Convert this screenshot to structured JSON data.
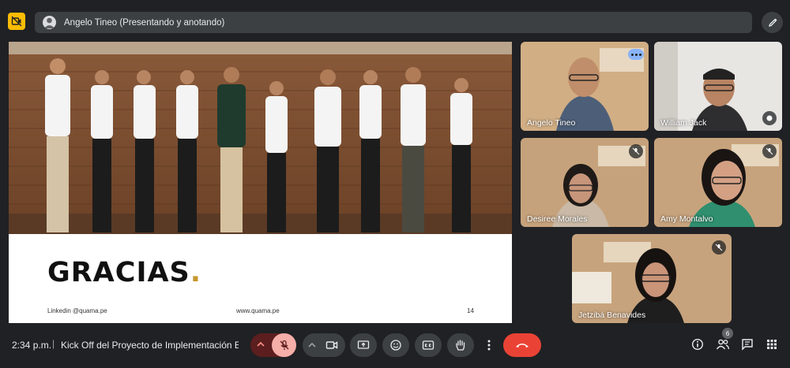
{
  "header": {
    "presenter_label": "Angelo Tineo (Presentando y anotando)"
  },
  "slide": {
    "title": "GRACIAS",
    "title_dot": ".",
    "footer_left": "Linkedin @quama.pe",
    "footer_center": "www.quama.pe",
    "page_number": "14"
  },
  "participants": [
    {
      "name": "Angelo Tineo",
      "status": "speaking"
    },
    {
      "name": "William Jack",
      "status": ""
    },
    {
      "name": "Desiree Morales",
      "status": "muted"
    },
    {
      "name": "Amy Montalvo",
      "status": "muted"
    },
    {
      "name": "Jetzibá Benavides",
      "status": "muted"
    }
  ],
  "footer": {
    "time": "2:34 p.m.",
    "separator": "|",
    "meeting_title": "Kick Off del Proyecto de Implementación Ex...",
    "participant_count": "6"
  },
  "icons": {
    "meet": "meet-logo-icon",
    "annotate": "pen-icon",
    "mic": "mic-off-icon",
    "camera": "camera-icon",
    "present": "present-screen-icon",
    "emoji": "emoji-icon",
    "captions": "captions-icon",
    "hand": "raise-hand-icon",
    "more": "more-vert-icon",
    "end": "end-call-icon",
    "info": "info-icon",
    "people": "people-icon",
    "chat": "chat-icon",
    "activities": "apps-icon"
  },
  "colors": {
    "background": "#202124",
    "accent_blue": "#8ab4f8",
    "end_call": "#ea4335",
    "mic_off": "#f6aea9",
    "meet_badge": "#fbbc04"
  }
}
